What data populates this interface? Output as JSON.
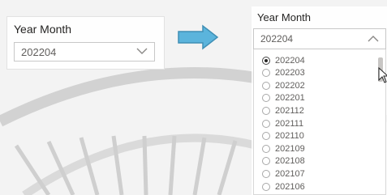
{
  "left_slicer": {
    "title": "Year Month",
    "selected_value": "202204",
    "chevron_icon": "chevron-down-icon"
  },
  "arrow_icon": "right-arrow-icon",
  "right_slicer": {
    "title": "Year Month",
    "selected_value": "202204",
    "chevron_icon": "chevron-up-icon",
    "options": [
      {
        "label": "202204",
        "selected": true
      },
      {
        "label": "202203",
        "selected": false
      },
      {
        "label": "202202",
        "selected": false
      },
      {
        "label": "202201",
        "selected": false
      },
      {
        "label": "202112",
        "selected": false
      },
      {
        "label": "202111",
        "selected": false
      },
      {
        "label": "202110",
        "selected": false
      },
      {
        "label": "202109",
        "selected": false
      },
      {
        "label": "202108",
        "selected": false
      },
      {
        "label": "202107",
        "selected": false
      },
      {
        "label": "202106",
        "selected": false
      }
    ]
  },
  "colors": {
    "arrow_fill": "#5bb4dc",
    "arrow_stroke": "#3f8fb5",
    "watermark": "#d2d2d2"
  }
}
